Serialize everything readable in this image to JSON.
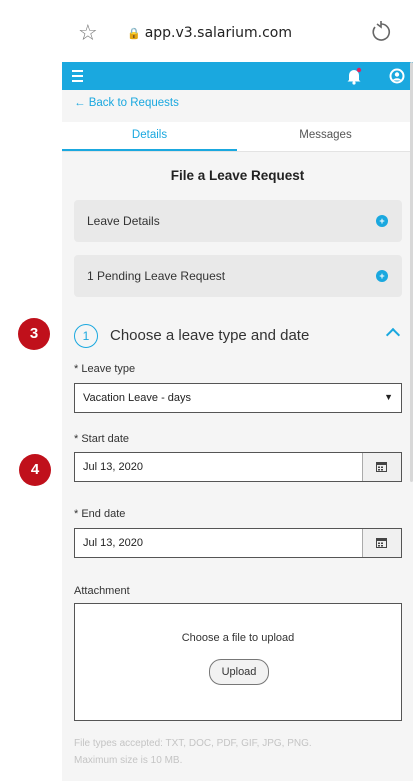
{
  "browser": {
    "url": "app.v3.salarium.com"
  },
  "header": {
    "accent_color": "#1aa8df",
    "notification_dot_color": "#e0245e"
  },
  "nav": {
    "back_label": "Back to Requests"
  },
  "tabs": [
    {
      "label": "Details",
      "active": true
    },
    {
      "label": "Messages",
      "active": false
    }
  ],
  "page": {
    "title": "File a Leave Request"
  },
  "accordions": [
    {
      "label": "Leave Details"
    },
    {
      "label": "1 Pending Leave Request"
    }
  ],
  "step": {
    "number": "1",
    "title": "Choose a leave type and date"
  },
  "form": {
    "leave_type": {
      "label": "* Leave type",
      "value": "Vacation Leave - days"
    },
    "start_date": {
      "label": "* Start date",
      "value": "Jul 13, 2020"
    },
    "end_date": {
      "label": "* End date",
      "value": "Jul 13, 2020"
    },
    "attachment": {
      "label": "Attachment",
      "prompt": "Choose a file to upload",
      "button": "Upload",
      "hint_types": "File types accepted: TXT, DOC, PDF, GIF, JPG, PNG.",
      "hint_size": "Maximum size is 10 MB."
    }
  },
  "annotations": [
    {
      "label": "3"
    },
    {
      "label": "4"
    }
  ]
}
